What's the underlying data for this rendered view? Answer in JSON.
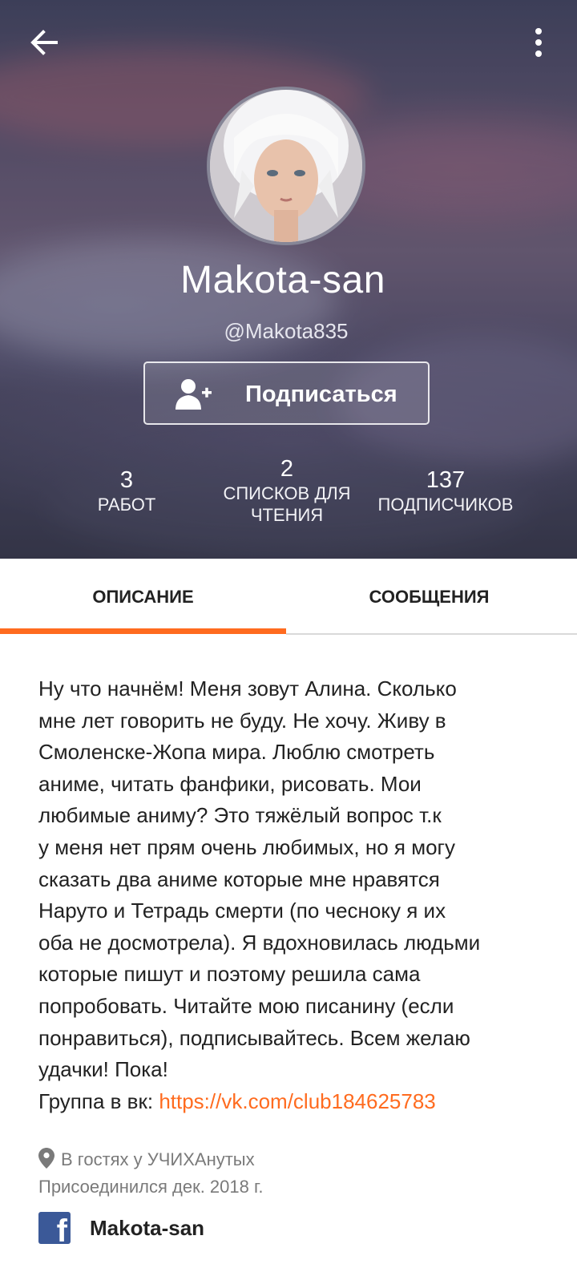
{
  "profile": {
    "display_name": "Makota-san",
    "handle": "@Makota835",
    "follow_label": "Подписаться"
  },
  "stats": [
    {
      "value": "3",
      "label_lines": [
        "РАБОТ"
      ]
    },
    {
      "value": "2",
      "label_lines": [
        "СПИСКОВ ДЛЯ",
        "ЧТЕНИЯ"
      ]
    },
    {
      "value": "137",
      "label_lines": [
        "ПОДПИСЧИКОВ"
      ]
    }
  ],
  "tabs": [
    {
      "label": "ОПИСАНИЕ",
      "active": true
    },
    {
      "label": "СООБЩЕНИЯ",
      "active": false
    }
  ],
  "description": {
    "lines": [
      "Ну что начнём! Меня зовут Алина. Сколько",
      "мне лет говорить не буду. Не хочу. Живу в",
      "Смоленске-Жопа мира. Люблю смотреть",
      "аниме, читать фанфики, рисовать. Мои",
      "любимые аниму? Это тяжёлый вопрос т.к",
      "у меня нет прям очень любимых, но я могу",
      "сказать два аниме которые мне нравятся",
      "Наруто и Тетрадь смерти (по чесноку я их",
      "оба не досмотрела). Я вдохновилась людьми",
      "которые пишут и поэтому решила сама",
      "попробовать. Читайте мою писанину (если",
      "понравиться), подписывайтесь. Всем желаю",
      "удачки! Пока!"
    ],
    "group_prefix": "Группа в вк: ",
    "group_link": "https://vk.com/club184625783"
  },
  "meta": {
    "location": "В гостях у УЧИХАнутых",
    "joined": "Присоединился дек. 2018 г."
  },
  "social": {
    "facebook_name": "Makota-san",
    "facebook_glyph": "f"
  },
  "colors": {
    "accent": "#ff6b1f",
    "facebook": "#3b5998"
  },
  "icons": {
    "back": "arrow-left-icon",
    "more": "vertical-dots-icon",
    "follow": "add-user-icon",
    "location": "map-pin-icon",
    "facebook": "facebook-icon"
  }
}
